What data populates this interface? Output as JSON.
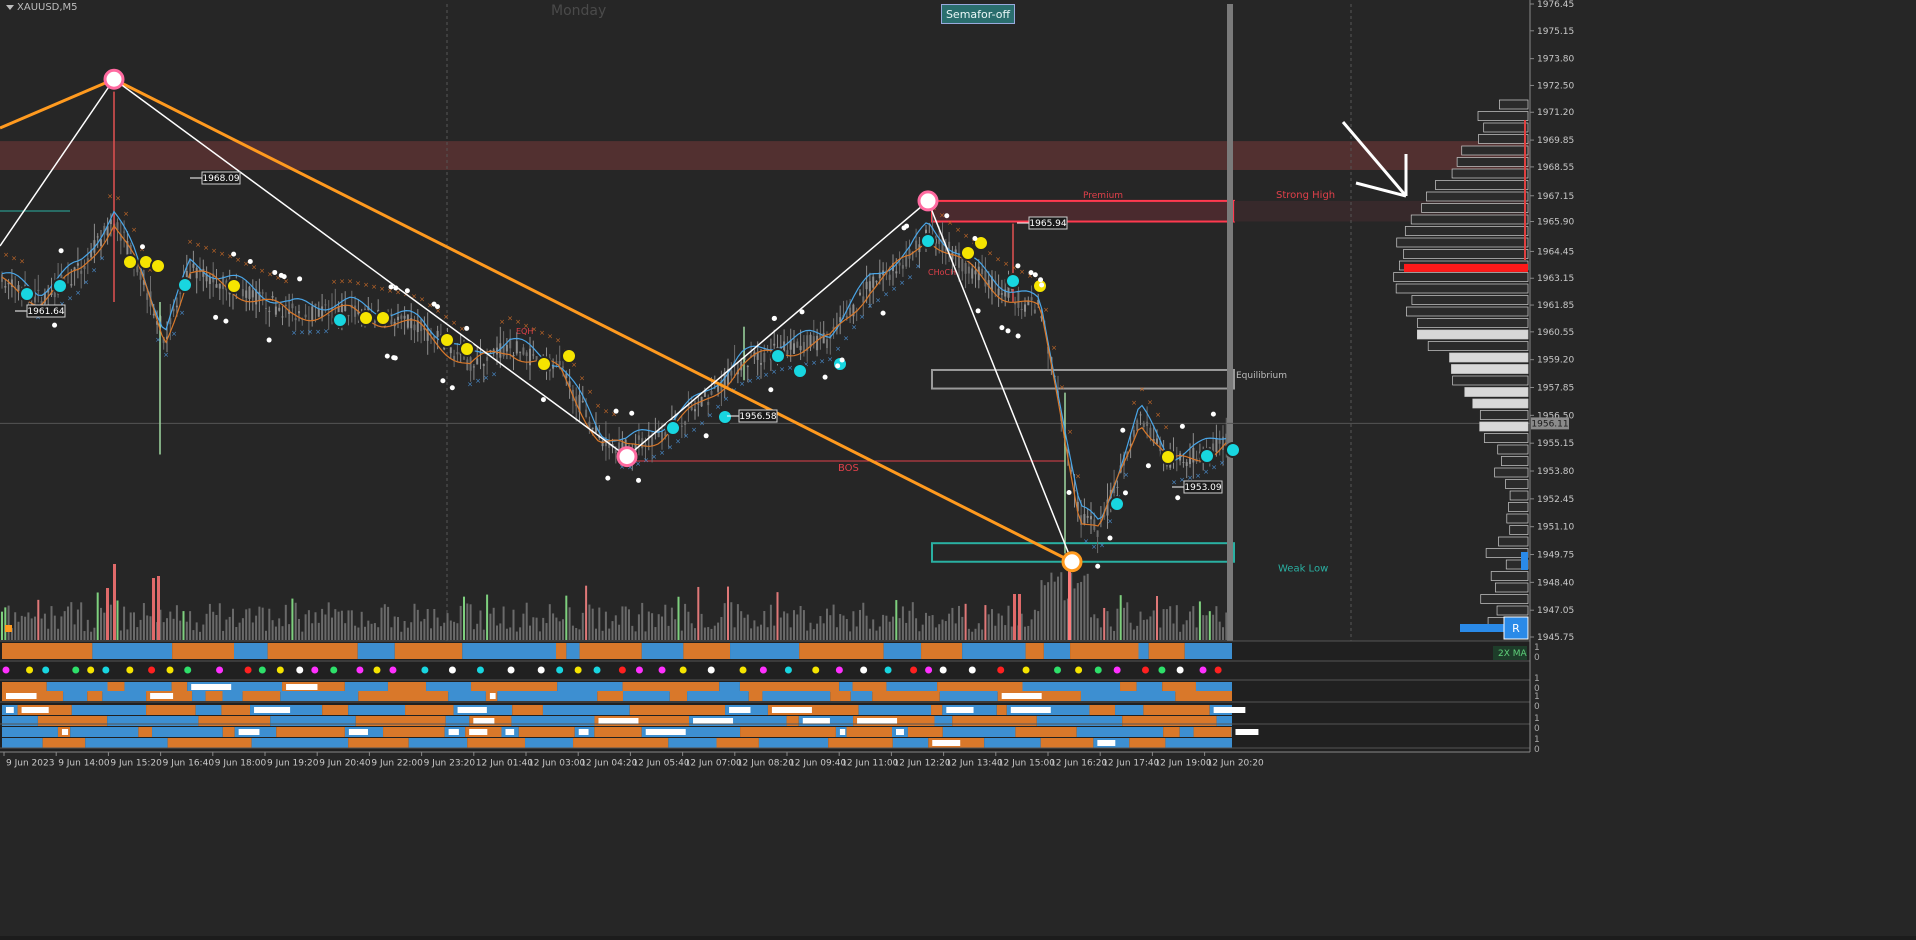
{
  "symbol": "XAUUSD,M5",
  "day_label": "Monday",
  "semafor_button": "Semafor-off",
  "current_price": "1956.11",
  "r_button": "R",
  "ma_label": "2X MA",
  "zone_labels": {
    "premium": "Premium",
    "strong_high": "Strong High",
    "equilibrium": "Equilibrium",
    "weak_low": "Weak Low",
    "bos": "BOS",
    "choch": "CHoCH",
    "eqh": "EQH"
  },
  "subpanel_scales": [
    {
      "top": "1",
      "bottom": "0"
    },
    {
      "top": "1",
      "bottom": "0"
    },
    {
      "top": "1",
      "bottom": "0"
    },
    {
      "top": "1",
      "bottom": "0"
    },
    {
      "top": "1",
      "bottom": "0"
    }
  ],
  "colors": {
    "background": "#262626",
    "bull": "#3d8fd1",
    "bear": "#d9782a",
    "zigzag": "#ff9a1f",
    "supply_zone": "#5a3232",
    "premium_box": "#ff3a4f",
    "weak_low_box": "#2ab0a2",
    "equilibrium_box": "#9a9a9a"
  },
  "chart_data": {
    "type": "candlestick",
    "title": "",
    "symbol": "XAUUSD",
    "timeframe": "M5",
    "y_axis": {
      "min": 1945.75,
      "max": 1976.45,
      "ticks": [
        "1976.45",
        "1975.15",
        "1973.80",
        "1972.50",
        "1971.20",
        "1969.85",
        "1968.55",
        "1967.15",
        "1965.90",
        "1964.45",
        "1963.15",
        "1961.85",
        "1960.55",
        "1959.20",
        "1957.85",
        "1956.50",
        "1955.15",
        "1953.80",
        "1952.45",
        "1951.10",
        "1949.75",
        "1948.40",
        "1947.05",
        "1945.75"
      ]
    },
    "x_axis": {
      "ticks": [
        "9 Jun 2023",
        "9 Jun 14:00",
        "9 Jun 15:20",
        "9 Jun 16:40",
        "9 Jun 18:00",
        "9 Jun 19:20",
        "9 Jun 20:40",
        "9 Jun 22:00",
        "9 Jun 23:20",
        "12 Jun 01:40",
        "12 Jun 03:00",
        "12 Jun 04:20",
        "12 Jun 05:40",
        "12 Jun 07:00",
        "12 Jun 08:20",
        "12 Jun 09:40",
        "12 Jun 11:00",
        "12 Jun 12:20",
        "12 Jun 13:40",
        "12 Jun 15:00",
        "12 Jun 16:20",
        "12 Jun 17:40",
        "12 Jun 19:00",
        "12 Jun 20:20"
      ]
    },
    "price_labels": [
      "1968.09",
      "1961.64",
      "1956.58",
      "1965.94",
      "1953.09"
    ],
    "swing_points": [
      {
        "time": "9 Jun 15:20",
        "price": 1972.8
      },
      {
        "time": "12 Jun 05:10",
        "price": 1954.5
      },
      {
        "time": "12 Jun 12:20",
        "price": 1966.9
      },
      {
        "time": "12 Jun 16:20",
        "price": 1949.4
      }
    ],
    "zones": [
      {
        "name": "Supply zone",
        "from": 1968.4,
        "to": 1969.8
      },
      {
        "name": "Premium / Strong High",
        "from": 1965.9,
        "to": 1966.9
      },
      {
        "name": "Equilibrium",
        "from": 1957.8,
        "to": 1958.7
      },
      {
        "name": "Weak Low",
        "from": 1949.4,
        "to": 1950.3
      }
    ],
    "grid": false,
    "legend": "none"
  }
}
